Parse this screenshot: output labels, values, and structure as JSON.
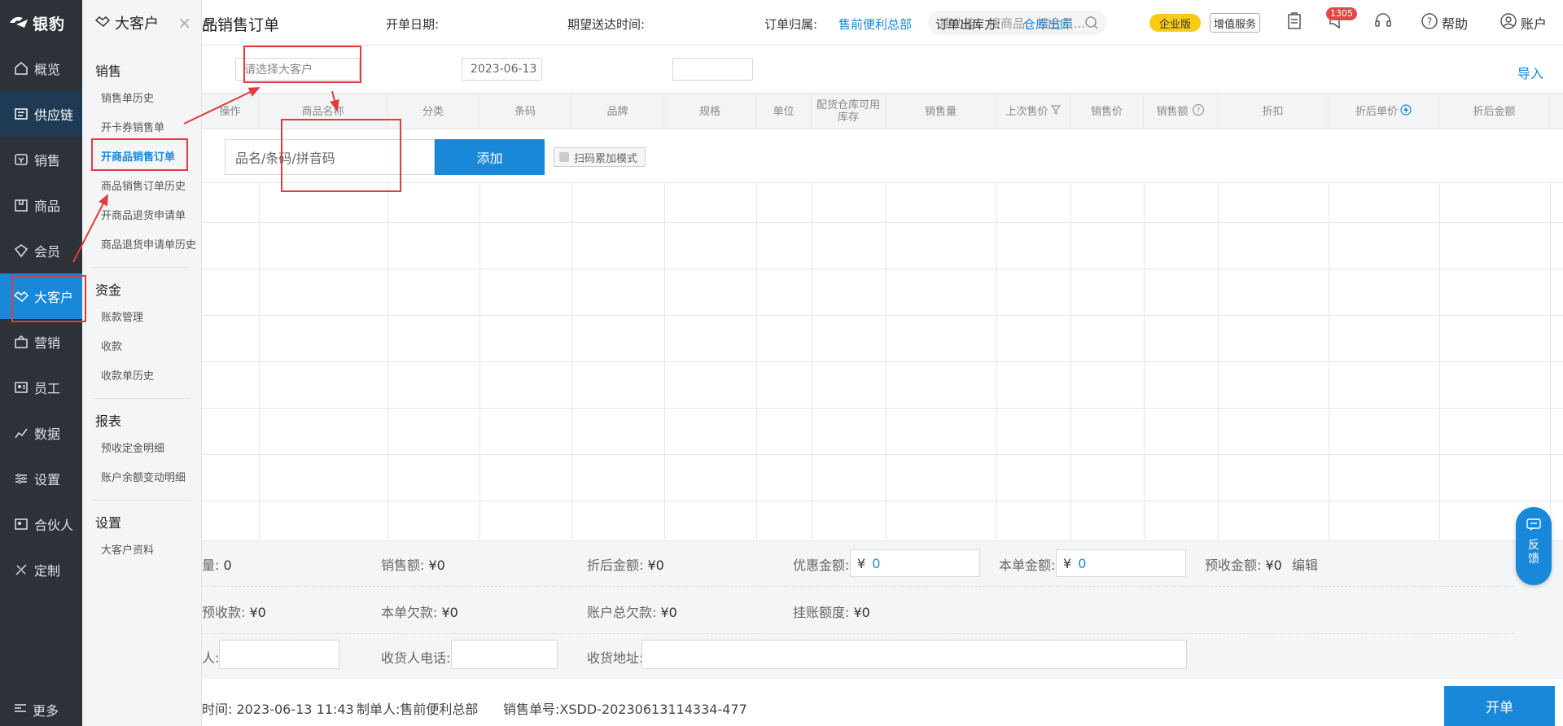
{
  "app": {
    "logo_text": "银豹"
  },
  "nav": {
    "items": [
      {
        "label": "概览",
        "icon": "home-icon"
      },
      {
        "label": "供应链",
        "icon": "supply-chain-icon"
      },
      {
        "label": "销售",
        "icon": "sales-icon"
      },
      {
        "label": "商品",
        "icon": "product-icon"
      },
      {
        "label": "会员",
        "icon": "member-icon"
      },
      {
        "label": "大客户",
        "icon": "handshake-icon"
      },
      {
        "label": "营销",
        "icon": "marketing-icon"
      },
      {
        "label": "员工",
        "icon": "staff-icon"
      },
      {
        "label": "数据",
        "icon": "chart-icon"
      },
      {
        "label": "设置",
        "icon": "settings-icon"
      },
      {
        "label": "合伙人",
        "icon": "partner-icon"
      },
      {
        "label": "定制",
        "icon": "custom-icon"
      }
    ],
    "more": "更多"
  },
  "submenu": {
    "title": "大客户",
    "groups": [
      {
        "name": "销售",
        "items": [
          "销售单历史",
          "开卡券销售单",
          "开商品销售订单",
          "商品销售订单历史",
          "开商品退货申请单",
          "商品退货申请单历史"
        ]
      },
      {
        "name": "资金",
        "items": [
          "账款管理",
          "收款",
          "收款单历史"
        ]
      },
      {
        "name": "报表",
        "items": [
          "预收定金明细",
          "账户余额变动明细"
        ]
      },
      {
        "name": "设置",
        "items": [
          "大客户资料"
        ]
      }
    ]
  },
  "topbar": {
    "title": "品销售订单",
    "search_placeholder": "搜功能、搜商品、搜会员...",
    "edition": "企业版",
    "vas": "增值服务",
    "notif_count": "1305",
    "help": "帮助",
    "account": "账户"
  },
  "form": {
    "customer_label": "户:",
    "customer_placeholder": "请选择大客户",
    "date_label": "开单日期:",
    "date_value": "2023-06-13",
    "expect_label": "期望送达时间:",
    "belong_label": "订单归属:",
    "belong_value": "售前便利总部",
    "warehouse_label": "订单出库方:",
    "warehouse_value": "仓库出库",
    "import": "导入"
  },
  "grid": {
    "columns": [
      "操作",
      "商品名称",
      "分类",
      "条码",
      "品牌",
      "规格",
      "单位",
      "配货仓库可用库存",
      "销售量",
      "上次售价",
      "销售价",
      "销售额",
      "折扣",
      "折后单价",
      "折后金额"
    ],
    "product_placeholder": "品名/条码/拼音码",
    "add": "添加",
    "scan_mode": "扫码累加模式"
  },
  "summary": {
    "qty_label": "量:",
    "qty_value": "0",
    "sales_label": "销售额:",
    "sales_value": "¥0",
    "disc_amount_label": "折后金额:",
    "disc_amount_value": "¥0",
    "promo_label": "优惠金额:",
    "promo_value": "0",
    "order_amount_label": "本单金额:",
    "order_amount_value": "0",
    "prepay_label": "预收金额:",
    "prepay_value": "¥0",
    "edit": "编辑",
    "prepay_recv_label": "预收款:",
    "prepay_recv_value": "¥0",
    "owed_label": "本单欠款:",
    "owed_value": "¥0",
    "total_owed_label": "账户总欠款:",
    "total_owed_value": "¥0",
    "credit_label": "挂账额度:",
    "credit_value": "¥0",
    "receiver_label": "人:",
    "receiver_phone_label": "收货人电话:",
    "receiver_addr_label": "收货地址:"
  },
  "footer": {
    "time_label": "时间:",
    "time_value": "2023-06-13 11:43",
    "maker_label": "制单人:",
    "maker_value": "售前便利总部",
    "no_label": "销售单号:",
    "no_value": "XSDD-20230613114334-477",
    "open": "开单"
  },
  "feedback": {
    "line1": "反",
    "line2": "馈"
  },
  "colors": {
    "primary": "#1a88d8",
    "sidebar": "#2d3238",
    "highlight": "#e23b3b",
    "edition": "#f9cb15"
  }
}
